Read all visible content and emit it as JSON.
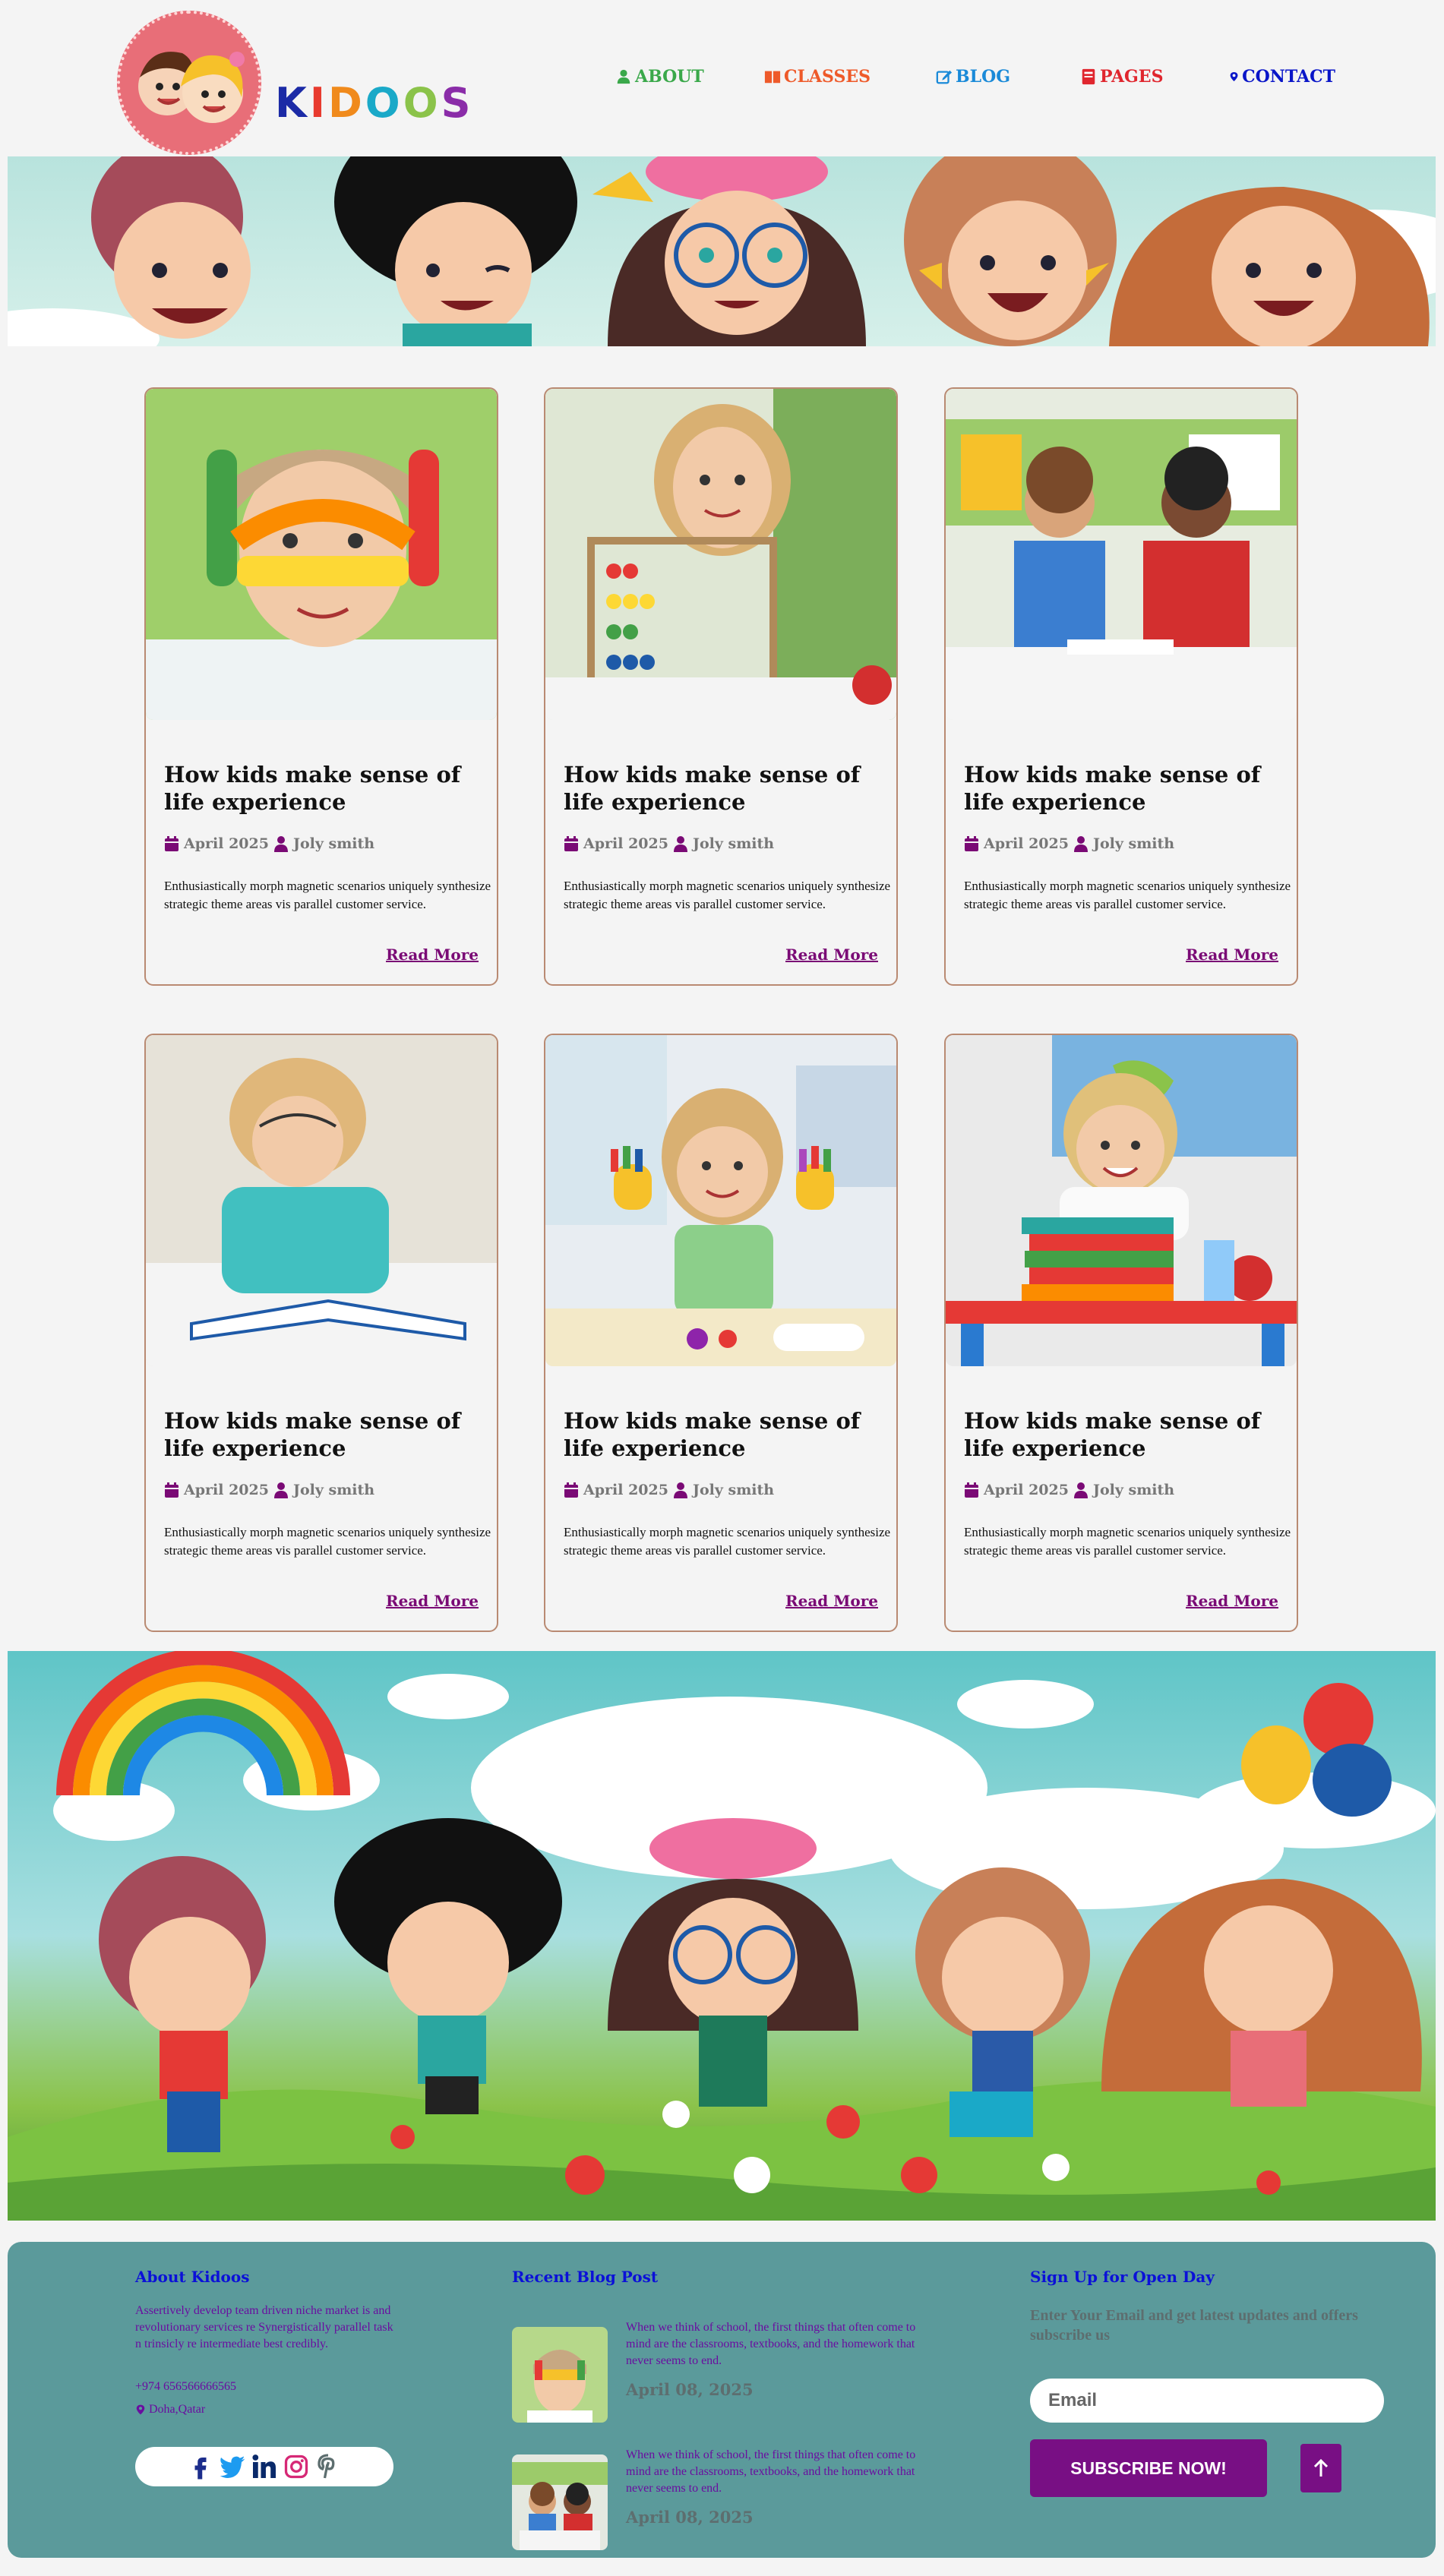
{
  "brand": {
    "logo_letters": [
      "K",
      "I",
      "D",
      "O",
      "O",
      "S"
    ],
    "logo_colors": [
      "#1b2aa6",
      "#e83a2e",
      "#f08a1c",
      "#1aa9c8",
      "#8bc34a",
      "#8a2ca8"
    ]
  },
  "nav": [
    {
      "label": "ABOUT",
      "icon": "user-icon",
      "color": "#3aa84a"
    },
    {
      "label": "CLASSES",
      "icon": "book-icon",
      "color": "#ee5a2a"
    },
    {
      "label": "BLOG",
      "icon": "edit-icon",
      "color": "#1a8ad8"
    },
    {
      "label": "PAGES",
      "icon": "document-icon",
      "color": "#e0262e"
    },
    {
      "label": "CONTACT",
      "icon": "location-pin-icon",
      "color": "#0a16c8"
    }
  ],
  "posts": [
    {
      "title": "How kids make sense of life experience",
      "date": "April 2025",
      "author": "Joly smith",
      "excerpt": "Enthusiastically morph magnetic scenarios uniquely synthesize strategic theme areas vis parallel customer service.",
      "link": "Read More",
      "image": "girl-painted-hands"
    },
    {
      "title": "How kids make sense of life experience",
      "date": "April 2025",
      "author": "Joly smith",
      "excerpt": "Enthusiastically morph magnetic scenarios uniquely synthesize strategic theme areas vis parallel customer service.",
      "link": "Read More",
      "image": "girl-abacus"
    },
    {
      "title": "How kids make sense of life experience",
      "date": "April 2025",
      "author": "Joly smith",
      "excerpt": "Enthusiastically morph magnetic scenarios uniquely synthesize strategic theme areas vis parallel customer service.",
      "link": "Read More",
      "image": "boys-at-desk"
    },
    {
      "title": "How kids make sense of life experience",
      "date": "April 2025",
      "author": "Joly smith",
      "excerpt": "Enthusiastically morph magnetic scenarios uniquely synthesize strategic theme areas vis parallel customer service.",
      "link": "Read More",
      "image": "girl-reading"
    },
    {
      "title": "How kids make sense of life experience",
      "date": "April 2025",
      "author": "Joly smith",
      "excerpt": "Enthusiastically morph magnetic scenarios uniquely synthesize strategic theme areas vis parallel customer service.",
      "link": "Read More",
      "image": "girl-painting"
    },
    {
      "title": "How kids make sense of life experience",
      "date": "April 2025",
      "author": "Joly smith",
      "excerpt": "Enthusiastically morph magnetic scenarios uniquely synthesize strategic theme areas vis parallel customer service.",
      "link": "Read More",
      "image": "girl-books-classroom"
    }
  ],
  "footer": {
    "about": {
      "heading": "About Kidoos",
      "text": "Assertively develop team driven niche market is and revolutionary services re Synergistically parallel task n trinsicly re intermediate best credibly.",
      "phone": "+974 656566666565",
      "location": "Doha,Qatar"
    },
    "blog": {
      "heading": "Recent Blog Post",
      "items": [
        {
          "text": "When we think of school, the first things that often come to mind are the classrooms, textbooks, and the homework that never seems to end.",
          "date": "April 08, 2025"
        },
        {
          "text": "When we think of school, the first things that often come to mind are the classrooms, textbooks, and the homework that never seems to end.",
          "date": "April 08, 2025"
        }
      ]
    },
    "signup": {
      "heading": "Sign Up for Open Day",
      "text": "Enter Your Email and get latest updates and offers subscribe us",
      "placeholder": "Email",
      "button": "SUBSCRIBE NOW!"
    },
    "social_icons": [
      "facebook-icon",
      "twitter-icon",
      "linkedin-icon",
      "instagram-icon",
      "pinterest-icon"
    ]
  },
  "colors": {
    "accent": "#780f84",
    "footer_bg": "#5b9a9b",
    "card_border": "#b98a72"
  }
}
